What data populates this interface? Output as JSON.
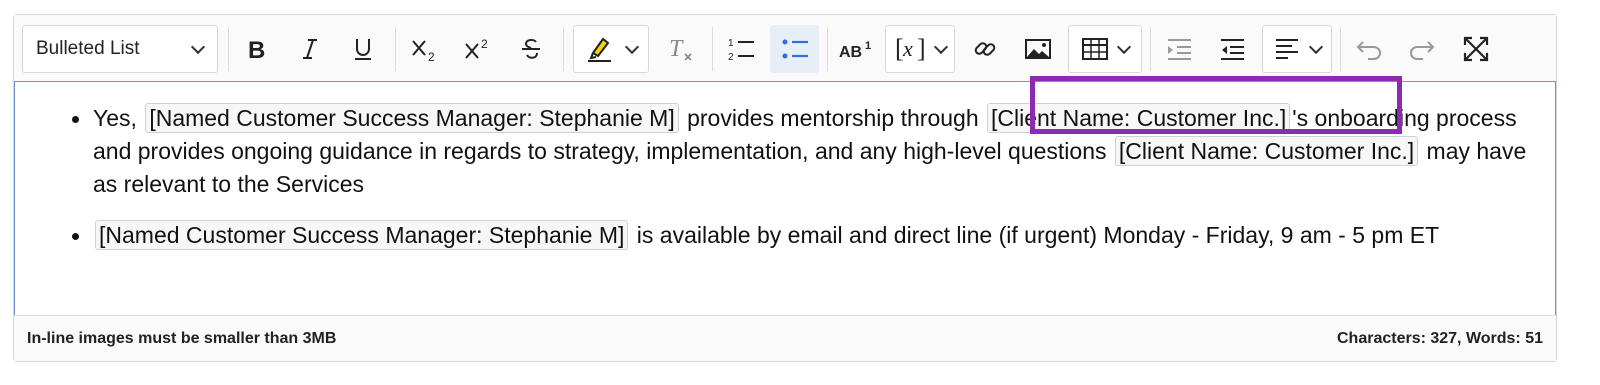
{
  "toolbar": {
    "heading_select_value": "Bulleted List",
    "icons": [
      "bold-icon",
      "italic-icon",
      "underline-icon",
      "subscript-icon",
      "superscript-icon",
      "strikethrough-icon",
      "highlight-icon",
      "remove-format-icon",
      "numbered-list-icon",
      "bulleted-list-icon",
      "text-transform-icon",
      "insert-variable-icon",
      "link-icon",
      "image-icon",
      "table-icon",
      "indent-icon",
      "outdent-icon",
      "align-icon",
      "undo-icon",
      "redo-icon",
      "fullscreen-icon"
    ]
  },
  "content": {
    "items": [
      {
        "prefix": "Yes,",
        "placeholder_1": "[Named Customer Success Manager: Stephanie M]",
        "mid_1": "provides mentorship through",
        "placeholder_2": "[Client Name: Customer Inc.]",
        "mid_2": "'s onboarding process and provides ongoing guidance in regards to strategy, implementation, and any high-level questions",
        "placeholder_3": "[Client Name: Customer Inc.]",
        "suffix": "may have as relevant to the Services"
      },
      {
        "placeholder_1": "[Named Customer Success Manager: Stephanie M]",
        "suffix": "is available by email and direct line (if urgent) Monday - Friday, 9 am - 5 pm ET"
      }
    ]
  },
  "footer": {
    "image_note": "In-line images must be smaller than 3MB",
    "counts": "Characters: 327, Words: 51"
  },
  "colors": {
    "highlight_frame": "#8c2bb1",
    "focus_border": "#6b93d6",
    "active_button_bg": "#e6eef9",
    "accent_blue": "#2f6fdb"
  }
}
